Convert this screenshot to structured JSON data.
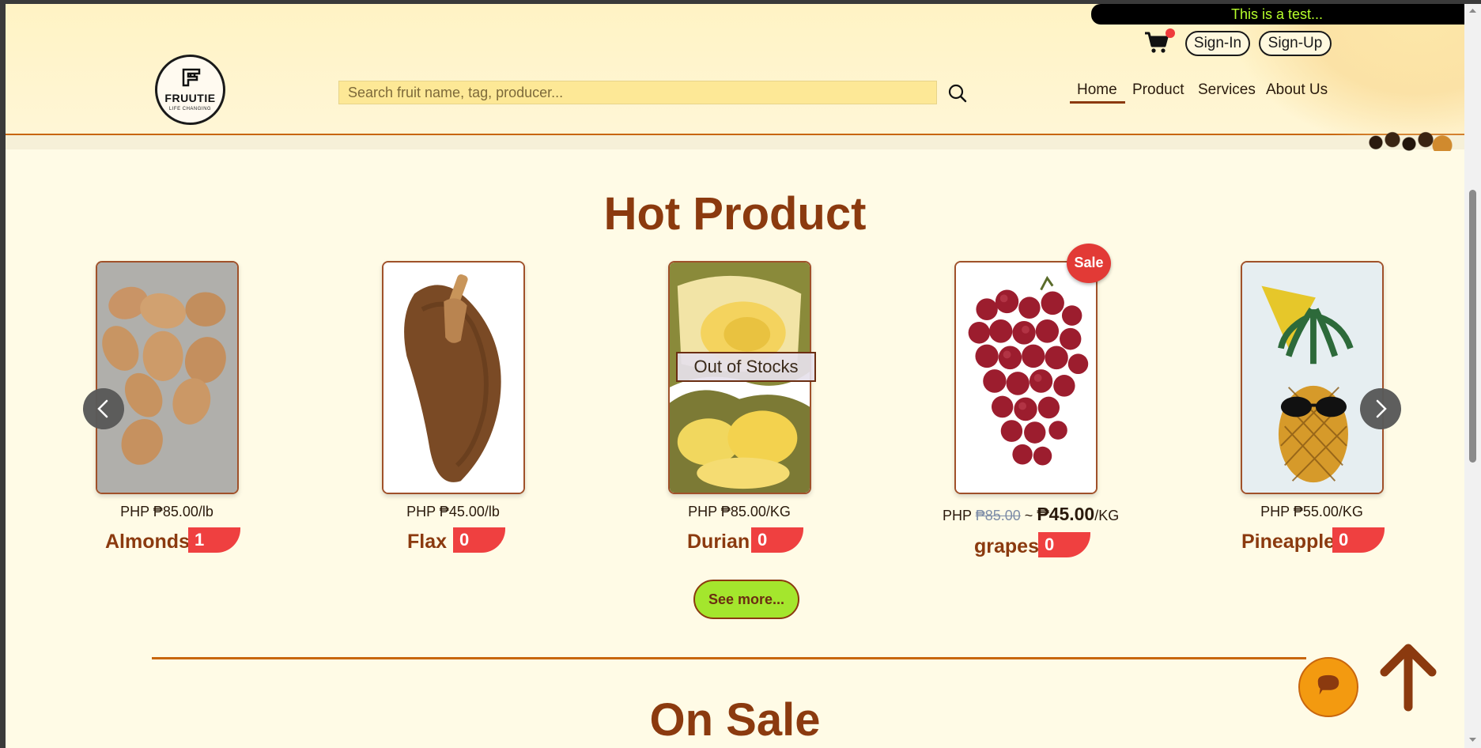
{
  "marquee": "This is a test...",
  "brand": {
    "name": "FRUUTIE",
    "tagline": "LIFE CHANGING"
  },
  "search": {
    "placeholder": "Search fruit name, tag, producer..."
  },
  "auth": {
    "signin": "Sign-In",
    "signup": "Sign-Up"
  },
  "nav": [
    {
      "label": "Home",
      "active": true
    },
    {
      "label": "Product",
      "active": false
    },
    {
      "label": "Services",
      "active": false
    },
    {
      "label": "About Us",
      "active": false
    }
  ],
  "hot": {
    "title": "Hot Product",
    "products": [
      {
        "name": "Almonds",
        "price": "PHP ₱85.00/lb",
        "count": "1"
      },
      {
        "name": "Flax",
        "price": "PHP ₱45.00/lb",
        "count": "0"
      },
      {
        "name": "Durian",
        "price": "PHP ₱85.00/KG",
        "count": "0",
        "status": "Out of Stocks"
      },
      {
        "name": "grapes",
        "price_prefix": "PHP",
        "old_price": "₱85.00",
        "sep": "~",
        "new_price": "₱45.00",
        "unit": "/KG",
        "count": "0",
        "badge": "Sale"
      },
      {
        "name": "Pineapple",
        "price": "PHP ₱55.00/KG",
        "count": "0"
      }
    ],
    "see_more": "See more..."
  },
  "sale": {
    "title": "On Sale"
  },
  "colors": {
    "brand": "#8b3a0f",
    "accent": "#c8660e",
    "count": "#ef4040",
    "see_more": "#a4e62d"
  }
}
